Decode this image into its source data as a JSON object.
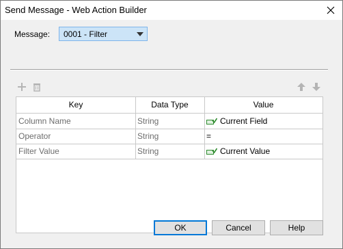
{
  "window": {
    "title": "Send Message - Web Action Builder"
  },
  "message": {
    "label": "Message:",
    "value": "0001 - Filter"
  },
  "toolbar": {
    "add_icon": "plus-icon",
    "delete_icon": "trash-icon",
    "up_icon": "arrow-up-icon",
    "down_icon": "arrow-down-icon"
  },
  "table": {
    "headers": [
      "Key",
      "Data Type",
      "Value"
    ],
    "rows": [
      {
        "key": "Column Name",
        "type": "String",
        "value": "Current Field",
        "value_icon": "field-icon"
      },
      {
        "key": "Operator",
        "type": "String",
        "value": "=",
        "value_icon": ""
      },
      {
        "key": "Filter Value",
        "type": "String",
        "value": "Current Value",
        "value_icon": "field-icon"
      }
    ]
  },
  "buttons": {
    "ok": "OK",
    "cancel": "Cancel",
    "help": "Help"
  },
  "colors": {
    "combo_fill": "#cce4f7",
    "combo_border": "#7eb4ea",
    "default_button_border": "#0078d7",
    "icon_green": "#2e8b2e"
  }
}
